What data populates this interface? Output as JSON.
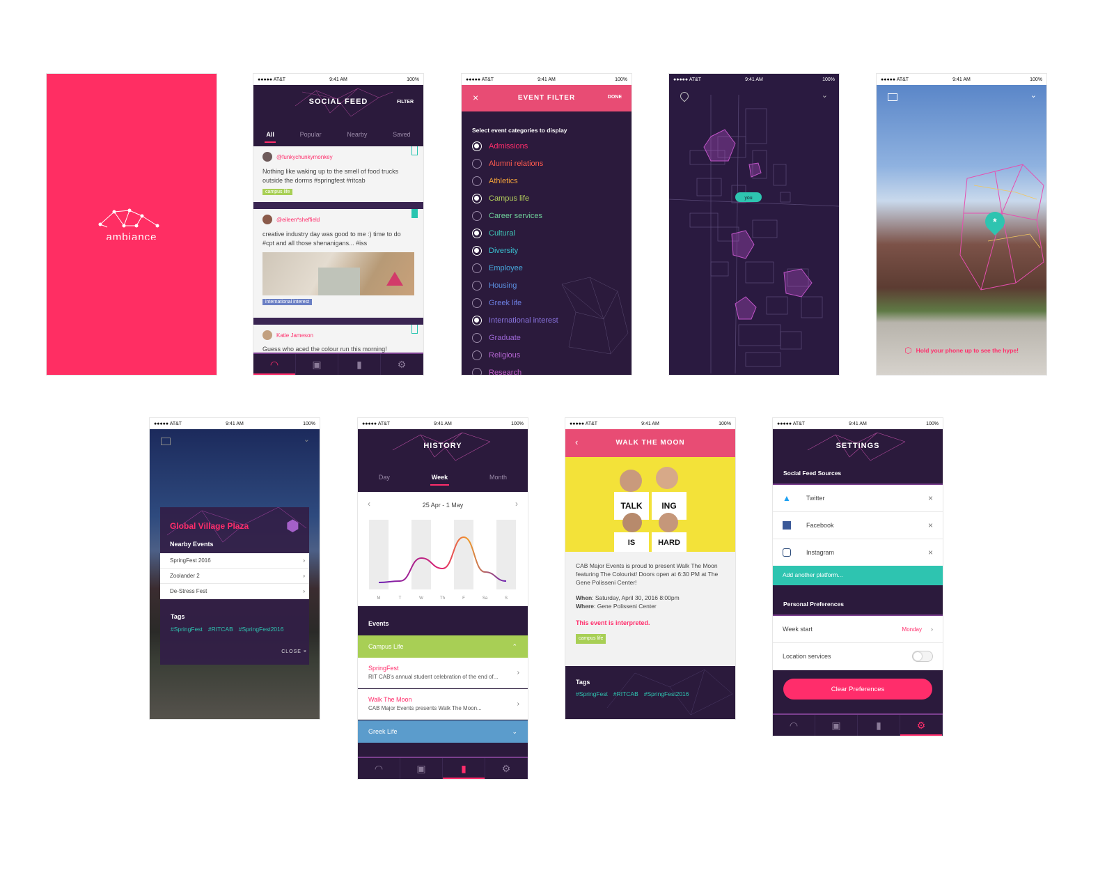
{
  "status": {
    "carrier": "●●●●● AT&T",
    "time": "9:41 AM",
    "battery": "100%"
  },
  "splash": {
    "bg": "#ff2e63",
    "logo_text": "ambiance"
  },
  "social": {
    "title": "SOCIAL FEED",
    "filter": "FILTER",
    "tabs": [
      "All",
      "Popular",
      "Nearby",
      "Saved"
    ],
    "posts": [
      {
        "user": "@funkychunkymonkey",
        "text": "Nothing like waking up to the smell of food trucks outside the dorms #springfest #ritcab",
        "tag": "campus life"
      },
      {
        "user": "@eileen*sheffield",
        "text": "creative industry day was good to me :) time to do #cpt and all those shenanigans... #iss",
        "tag": "international interest"
      },
      {
        "user": "Katie Jameson",
        "text": "Guess who aced the colour run this morning!"
      }
    ]
  },
  "filter": {
    "title": "EVENT FILTER",
    "close": "×",
    "done": "DONE",
    "prompt": "Select event categories to display",
    "categories": [
      {
        "label": "Admissions",
        "color": "#ff2d6b",
        "on": true
      },
      {
        "label": "Alumni relations",
        "color": "#ff5a4e",
        "on": false
      },
      {
        "label": "Athletics",
        "color": "#f2a23a",
        "on": false
      },
      {
        "label": "Campus life",
        "color": "#b5d15c",
        "on": true
      },
      {
        "label": "Career services",
        "color": "#6fd09a",
        "on": false
      },
      {
        "label": "Cultural",
        "color": "#3fc9b8",
        "on": true
      },
      {
        "label": "Diversity",
        "color": "#39c0d0",
        "on": true
      },
      {
        "label": "Employee",
        "color": "#47a9dc",
        "on": false
      },
      {
        "label": "Housing",
        "color": "#5b8fe0",
        "on": false
      },
      {
        "label": "Greek life",
        "color": "#6d7fe2",
        "on": false
      },
      {
        "label": "International interest",
        "color": "#8a74e0",
        "on": true
      },
      {
        "label": "Graduate",
        "color": "#9c67d6",
        "on": false
      },
      {
        "label": "Religious",
        "color": "#b263d0",
        "on": false
      },
      {
        "label": "Research",
        "color": "#c25fc8",
        "on": false
      }
    ]
  },
  "map": {
    "you_label": "you"
  },
  "ar": {
    "hint": "Hold your phone up to see the hype!"
  },
  "plaza": {
    "title": "Global Village Plaza",
    "nearby_label": "Nearby Events",
    "events": [
      "SpringFest 2016",
      "Zoolander 2",
      "De-Stress Fest"
    ],
    "tags_label": "Tags",
    "tags": [
      "#SpringFest",
      "#RITCAB",
      "#SpringFest2016"
    ],
    "close": "CLOSE ×"
  },
  "history": {
    "title": "HISTORY",
    "tabs": [
      "Day",
      "Week",
      "Month"
    ],
    "range": "25 Apr - 1 May",
    "events_label": "Events",
    "group1": "Campus Life",
    "items": [
      {
        "title": "SpringFest",
        "desc": "RIT CAB's annual student celebration of the end of..."
      },
      {
        "title": "Walk The Moon",
        "desc": "CAB Major Events presents Walk The Moon..."
      }
    ],
    "group2": "Greek Life"
  },
  "event": {
    "title": "WALK THE MOON",
    "shirt1": "TALK",
    "shirt2": "ING",
    "shirt3": "IS",
    "shirt4": "HARD",
    "desc": "CAB Major Events is proud to present Walk The Moon featuring The Colourist! Doors open at 6:30 PM at The Gene Polisseni Center!",
    "when_label": "When",
    "when": ": Saturday, April 30, 2016 8:00pm",
    "where_label": "Where",
    "where": ": Gene Polisseni Center",
    "interpreted": "This event is interpreted.",
    "tag": "campus life",
    "tags_label": "Tags",
    "tags": [
      "#SpringFest",
      "#RITCAB",
      "#SpringFest2016"
    ]
  },
  "settings": {
    "title": "SETTINGS",
    "sources_label": "Social Feed Sources",
    "sources": [
      "Twitter",
      "Facebook",
      "Instagram"
    ],
    "add": "Add another platform...",
    "prefs_label": "Personal Preferences",
    "week_start_label": "Week start",
    "week_start_value": "Monday",
    "location_label": "Location services",
    "clear": "Clear Preferences"
  },
  "chart_data": {
    "type": "area",
    "categories": [
      "M",
      "T",
      "W",
      "Th",
      "F",
      "Sa",
      "S"
    ],
    "values": [
      0.1,
      0.12,
      0.45,
      0.3,
      0.75,
      0.25,
      0.12
    ],
    "title": "",
    "xlabel": "",
    "ylabel": "",
    "ylim": [
      0,
      1
    ]
  },
  "colors": {
    "pink": "#ff2d6b",
    "purple": "#2b1a3c",
    "teal": "#2ec4b0",
    "lime": "#a8cf55",
    "blue": "#5b9ccc"
  }
}
